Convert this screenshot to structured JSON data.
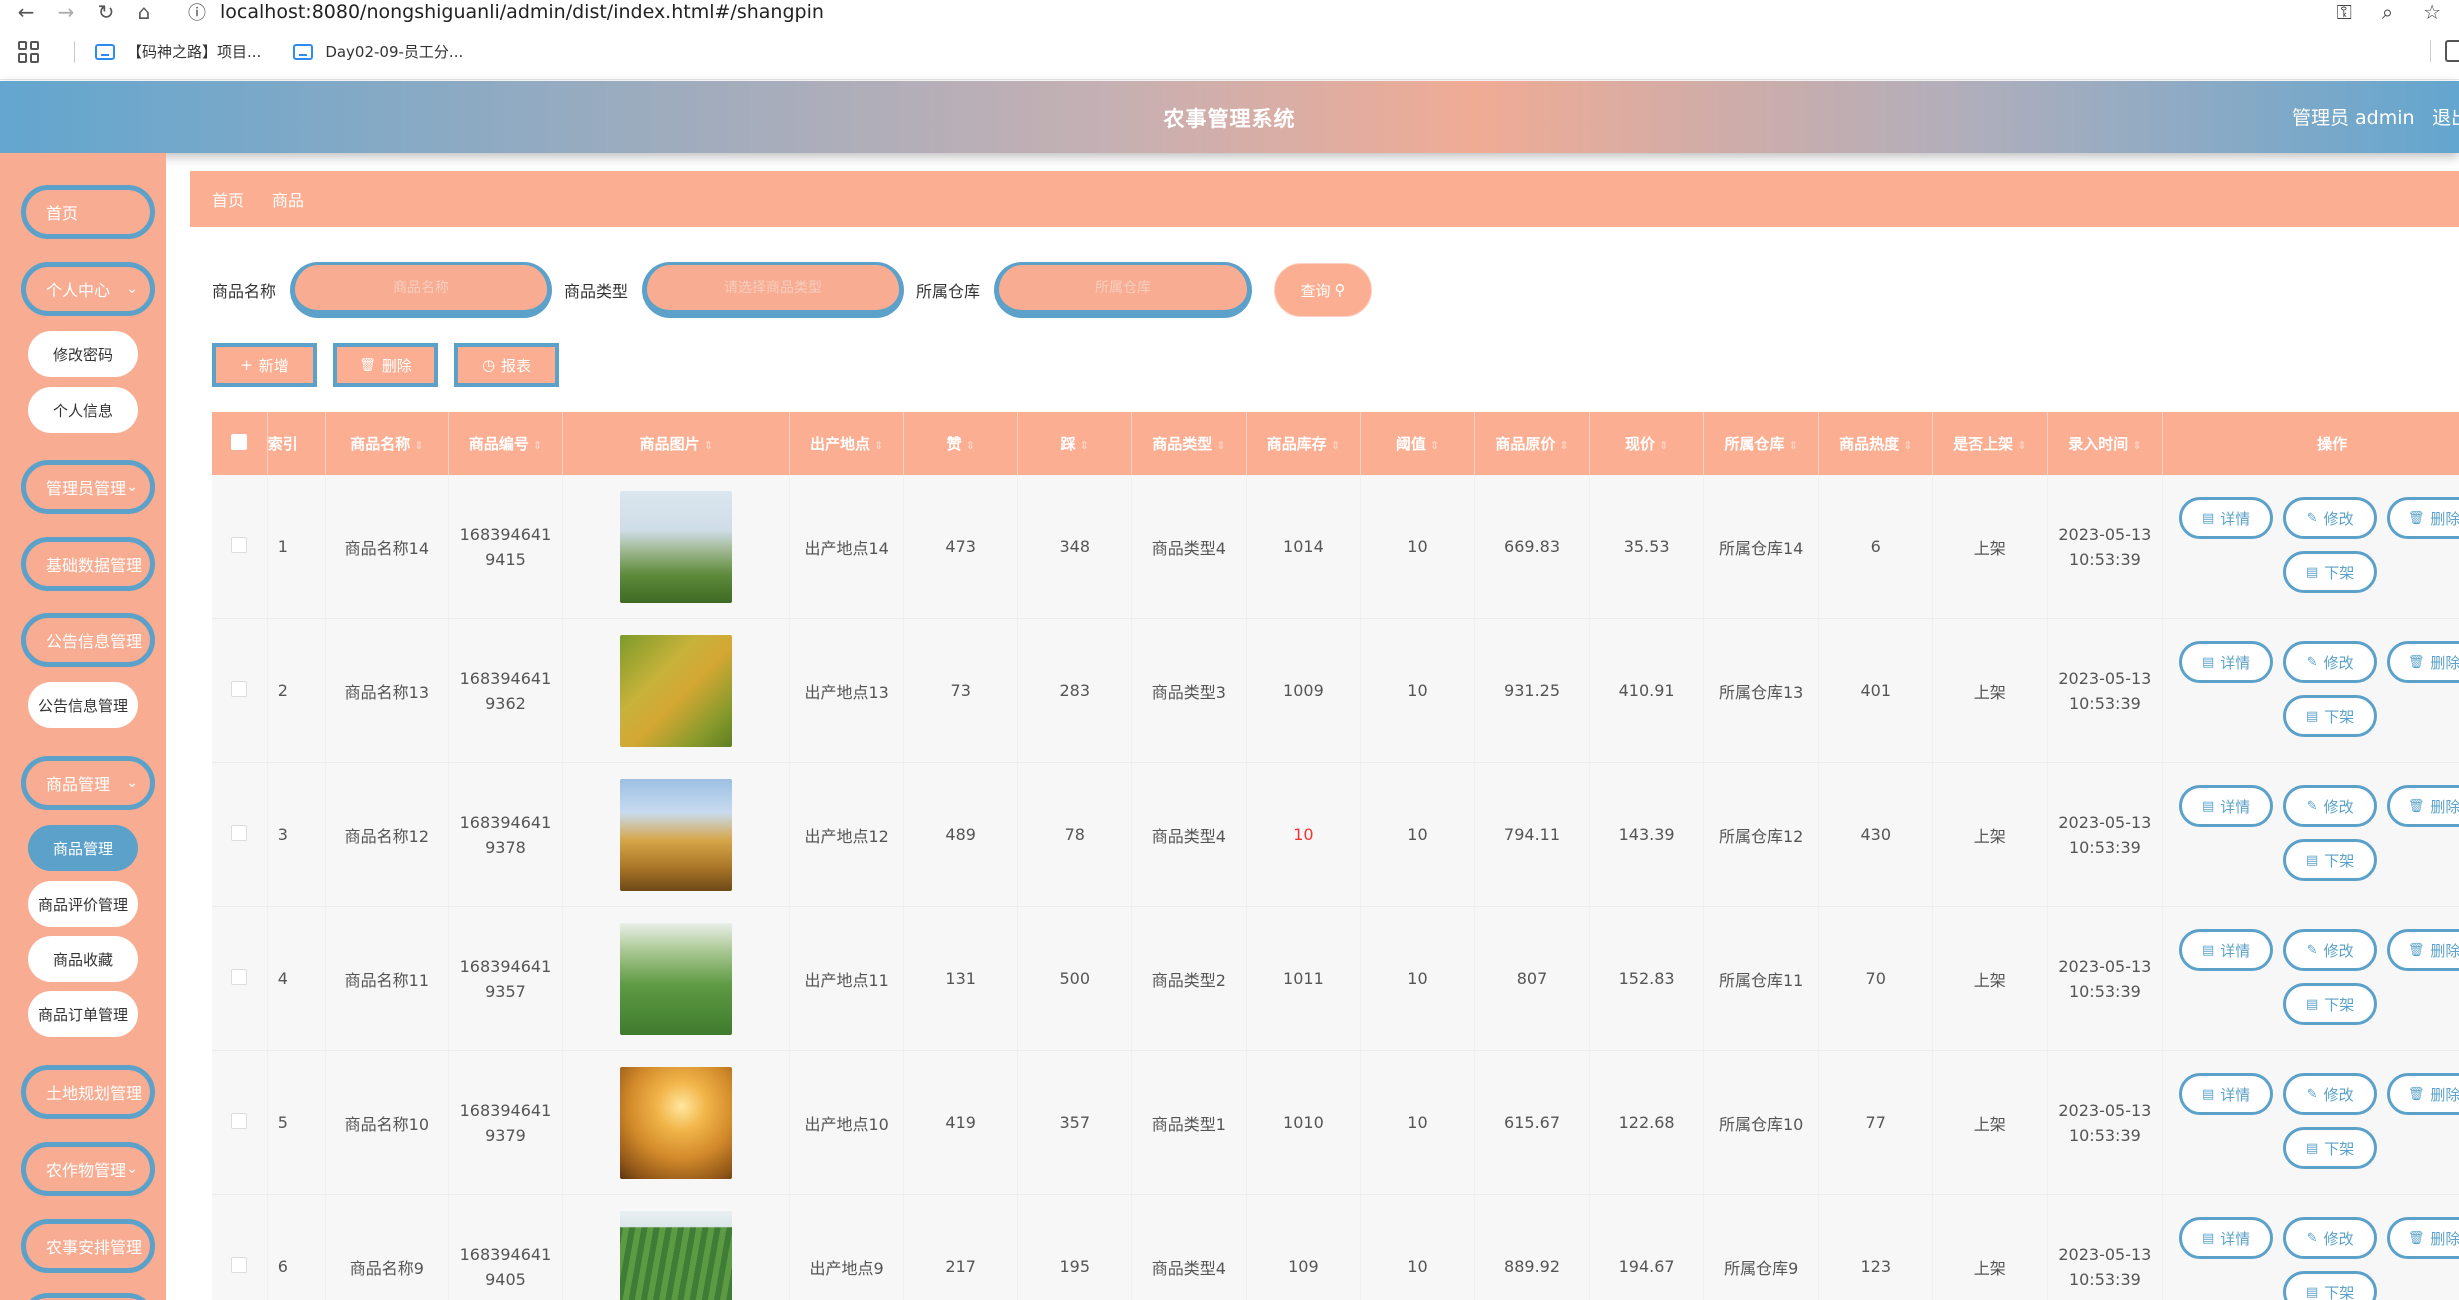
{
  "browser": {
    "url": "localhost:8080/nongshiguanli/admin/dist/index.html#/shangpin",
    "bookmarks": [
      "【码神之路】项目...",
      "Day02-09-员工分..."
    ]
  },
  "header": {
    "title": "农事管理系统",
    "admin_label": "管理员 admin",
    "logout_label": "退出登录"
  },
  "sidebar": {
    "home": "首页",
    "personal_center": "个人中心",
    "change_password": "修改密码",
    "personal_info": "个人信息",
    "admin_manage": "管理员管理",
    "base_data_manage": "基础数据管理",
    "notice_manage": "公告信息管理",
    "notice_manage_sub": "公告信息管理",
    "goods_manage": "商品管理",
    "goods_manage_sub": "商品管理",
    "goods_review_manage": "商品评价管理",
    "goods_favorite": "商品收藏",
    "goods_order_manage": "商品订单管理",
    "land_plan_manage": "土地规划管理",
    "crop_manage": "农作物管理",
    "farm_schedule_manage": "农事安排管理"
  },
  "breadcrumb": {
    "home": "首页",
    "current": "商品"
  },
  "search": {
    "name_label": "商品名称",
    "name_placeholder": "商品名称",
    "type_label": "商品类型",
    "type_placeholder": "请选择商品类型",
    "warehouse_label": "所属仓库",
    "warehouse_placeholder": "所属仓库",
    "query_button": "查询"
  },
  "actions": {
    "add": "新增",
    "delete": "删除",
    "report": "报表"
  },
  "table": {
    "columns": [
      "索引",
      "商品名称",
      "商品编号",
      "商品图片",
      "出产地点",
      "赞",
      "踩",
      "商品类型",
      "商品库存",
      "阈值",
      "商品原价",
      "现价",
      "所属仓库",
      "商品热度",
      "是否上架",
      "录入时间",
      "操作"
    ],
    "op_labels": {
      "detail": "详情",
      "edit": "修改",
      "delete": "删除",
      "off_shelf": "下架"
    },
    "rows": [
      {
        "index": "1",
        "name": "商品名称14",
        "code_a": "168394641",
        "code_b": "9415",
        "place": "出产地点14",
        "like": "473",
        "dislike": "348",
        "type": "商品类型4",
        "stock": "1014",
        "threshold": "10",
        "orig_price": "669.83",
        "price": "35.53",
        "warehouse": "所属仓库14",
        "heat": "6",
        "on_shelf": "上架",
        "date": "2023-05-13",
        "time": "10:53:39"
      },
      {
        "index": "2",
        "name": "商品名称13",
        "code_a": "168394641",
        "code_b": "9362",
        "place": "出产地点13",
        "like": "73",
        "dislike": "283",
        "type": "商品类型3",
        "stock": "1009",
        "threshold": "10",
        "orig_price": "931.25",
        "price": "410.91",
        "warehouse": "所属仓库13",
        "heat": "401",
        "on_shelf": "上架",
        "date": "2023-05-13",
        "time": "10:53:39"
      },
      {
        "index": "3",
        "name": "商品名称12",
        "code_a": "168394641",
        "code_b": "9378",
        "place": "出产地点12",
        "like": "489",
        "dislike": "78",
        "type": "商品类型4",
        "stock": "10",
        "threshold": "10",
        "orig_price": "794.11",
        "price": "143.39",
        "warehouse": "所属仓库12",
        "heat": "430",
        "on_shelf": "上架",
        "date": "2023-05-13",
        "time": "10:53:39"
      },
      {
        "index": "4",
        "name": "商品名称11",
        "code_a": "168394641",
        "code_b": "9357",
        "place": "出产地点11",
        "like": "131",
        "dislike": "500",
        "type": "商品类型2",
        "stock": "1011",
        "threshold": "10",
        "orig_price": "807",
        "price": "152.83",
        "warehouse": "所属仓库11",
        "heat": "70",
        "on_shelf": "上架",
        "date": "2023-05-13",
        "time": "10:53:39"
      },
      {
        "index": "5",
        "name": "商品名称10",
        "code_a": "168394641",
        "code_b": "9379",
        "place": "出产地点10",
        "like": "419",
        "dislike": "357",
        "type": "商品类型1",
        "stock": "1010",
        "threshold": "10",
        "orig_price": "615.67",
        "price": "122.68",
        "warehouse": "所属仓库10",
        "heat": "77",
        "on_shelf": "上架",
        "date": "2023-05-13",
        "time": "10:53:39"
      },
      {
        "index": "6",
        "name": "商品名称9",
        "code_a": "168394641",
        "code_b": "9405",
        "place": "出产地点9",
        "like": "217",
        "dislike": "195",
        "type": "商品类型4",
        "stock": "109",
        "threshold": "10",
        "orig_price": "889.92",
        "price": "194.67",
        "warehouse": "所属仓库9",
        "heat": "123",
        "on_shelf": "上架",
        "date": "2023-05-13",
        "time": "10:53:39"
      }
    ]
  },
  "colors": {
    "header_gradient_start": "#63a6cf",
    "accent_salmon": "#fcae92",
    "accent_blue": "#5ba1c9",
    "low_stock": "#e33333"
  }
}
